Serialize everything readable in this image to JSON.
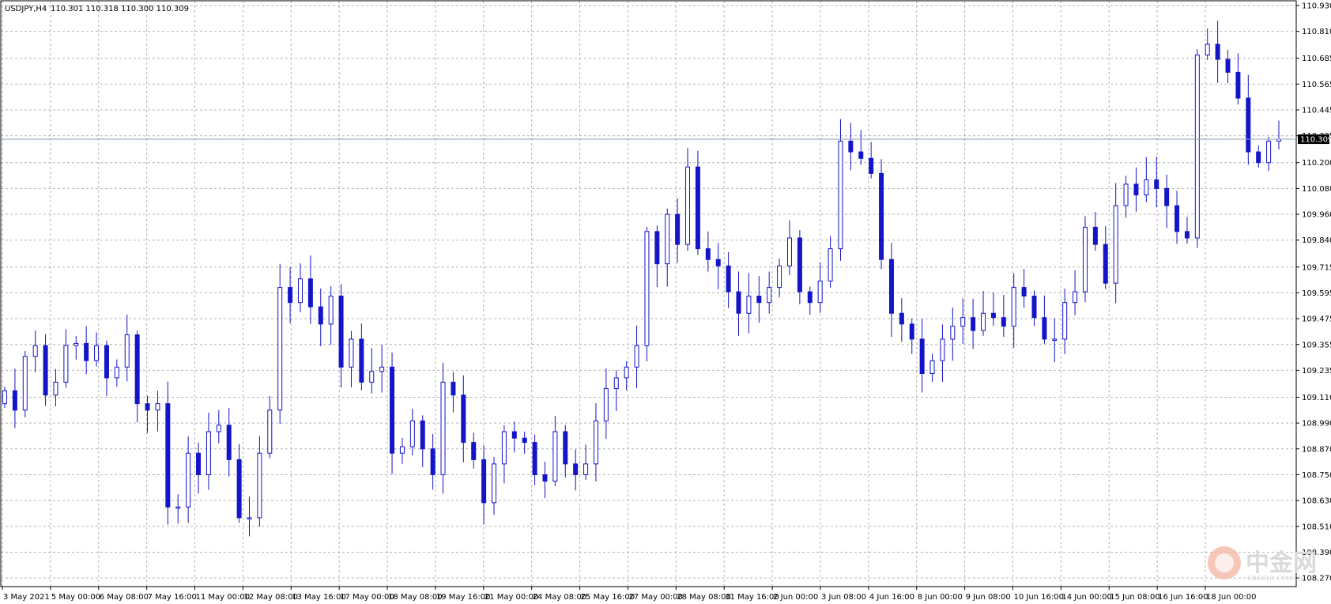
{
  "header": {
    "symbol": "USDJPY,H4",
    "ohlc": "110.301 110.318 110.300 110.309"
  },
  "watermark": {
    "main": "中金网",
    "site": "CNGOLD.COM.CN"
  },
  "colors": {
    "candle": "#1414c8",
    "grid": "#b4b4b4",
    "current_price_line": "#8ca0b4",
    "current_price_label_bg": "#000000"
  },
  "chart_data": {
    "type": "candlestick",
    "symbol": "USDJPY",
    "timeframe": "H4",
    "ylim": [
      108.23,
      110.93
    ],
    "y_ticks": [
      "110.930",
      "110.810",
      "110.685",
      "110.565",
      "110.445",
      "110.325",
      "110.200",
      "110.080",
      "109.960",
      "109.840",
      "109.715",
      "109.595",
      "109.475",
      "109.355",
      "109.235",
      "109.110",
      "108.990",
      "108.870",
      "108.750",
      "108.630",
      "108.510",
      "108.390",
      "108.270"
    ],
    "current_price": "110.309",
    "x_labels": [
      "3 May 2021",
      "5 May 00:00",
      "6 May 08:00",
      "7 May 16:00",
      "11 May 00:00",
      "12 May 08:00",
      "13 May 16:00",
      "17 May 00:00",
      "18 May 08:00",
      "19 May 16:00",
      "21 May 00:00",
      "24 May 08:00",
      "25 May 16:00",
      "27 May 00:00",
      "28 May 08:00",
      "31 May 16:00",
      "2 Jun 00:00",
      "3 Jun 08:00",
      "4 Jun 16:00",
      "8 Jun 00:00",
      "9 Jun 08:00",
      "10 Jun 16:00",
      "14 Jun 00:00",
      "15 Jun 08:00",
      "16 Jun 16:00",
      "18 Jun 00:00"
    ],
    "close_path": [
      109.14,
      109.05,
      109.3,
      109.35,
      109.12,
      109.18,
      109.35,
      109.36,
      109.28,
      109.35,
      109.2,
      109.25,
      109.4,
      109.08,
      109.05,
      109.08,
      108.6,
      108.6,
      108.85,
      108.75,
      108.95,
      108.98,
      108.82,
      108.55,
      108.55,
      108.85,
      109.05,
      109.62,
      109.55,
      109.66,
      109.53,
      109.45,
      109.58,
      109.25,
      109.38,
      109.18,
      109.23,
      109.25,
      108.85,
      108.88,
      109.0,
      108.87,
      108.75,
      109.18,
      109.12,
      108.9,
      108.82,
      108.62,
      108.8,
      108.95,
      108.92,
      108.9,
      108.75,
      108.72,
      108.95,
      108.8,
      108.75,
      108.8,
      109.0,
      109.15,
      109.2,
      109.25,
      109.35,
      109.88,
      109.73,
      109.96,
      109.82,
      110.18,
      109.8,
      109.75,
      109.72,
      109.6,
      109.5,
      109.58,
      109.55,
      109.62,
      109.72,
      109.85,
      109.6,
      109.55,
      109.65,
      109.8,
      110.3,
      110.25,
      110.22,
      110.15,
      109.75,
      109.5,
      109.45,
      109.38,
      109.22,
      109.28,
      109.38,
      109.44,
      109.48,
      109.42,
      109.5,
      109.48,
      109.44,
      109.62,
      109.58,
      109.48,
      109.38,
      109.38,
      109.55,
      109.6,
      109.9,
      109.82,
      109.64,
      110.0,
      110.1,
      110.05,
      110.12,
      110.08,
      110.0,
      109.88,
      109.85,
      110.7,
      110.75,
      110.68,
      110.62,
      110.5,
      110.25,
      110.2,
      110.3,
      110.309
    ]
  }
}
